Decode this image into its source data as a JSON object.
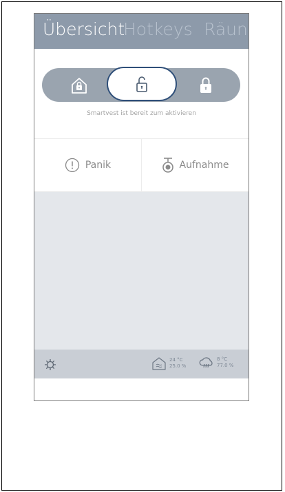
{
  "header": {
    "tabs": [
      {
        "label": "Übersicht",
        "active": true
      },
      {
        "label": "Hotkeys",
        "active": false
      },
      {
        "label": "Räun",
        "active": false
      }
    ]
  },
  "arm_control": {
    "modes": [
      "home",
      "disarmed",
      "armed"
    ],
    "selected": "disarmed",
    "status_text": "Smartvest ist bereit zum aktivieren"
  },
  "actions": {
    "panic_label": "Panik",
    "record_label": "Aufnahme"
  },
  "footer": {
    "indoor": {
      "temperature": "24 °C",
      "humidity": "25.0 %"
    },
    "outdoor": {
      "temperature": "8 °C",
      "humidity": "77.0 %"
    }
  },
  "colors": {
    "header_bg": "#8d9aaa",
    "accent_border": "#2f4f79",
    "content_bg": "#e4e7eb",
    "footer_bg": "#c9ced5"
  }
}
